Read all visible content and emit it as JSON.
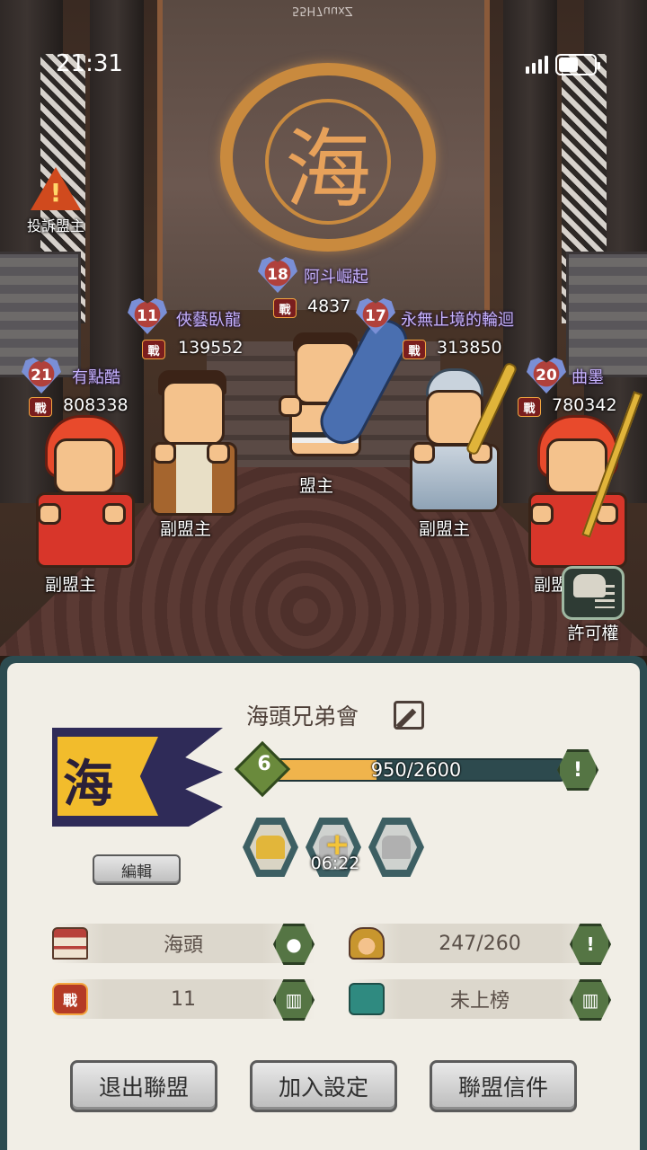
{
  "status_bar": {
    "time": "21:31",
    "battery_level": 0.55
  },
  "hall": {
    "banner_char": "海",
    "banner_id": "55H7uuxZ",
    "report_button_label": "投訴盟主",
    "permission_button_label": "許可權"
  },
  "members": [
    {
      "level": "18",
      "name": "阿斗崛起",
      "power": "4837",
      "role": "盟主"
    },
    {
      "level": "11",
      "name": "俠藝臥龍",
      "power": "139552",
      "role": "副盟主"
    },
    {
      "level": "17",
      "name": "永無止境的輪迴",
      "power": "313850",
      "role": "副盟主"
    },
    {
      "level": "21",
      "name": "有點酷",
      "power": "808338",
      "role": "副盟主"
    },
    {
      "level": "20",
      "name": "曲墨",
      "power": "780342",
      "role": "副盟"
    }
  ],
  "power_badge_label": "戰",
  "guild": {
    "flag_char": "海",
    "edit_button_label": "編輯",
    "name": "海頭兄弟會",
    "level": "6",
    "xp_text": "950/2600",
    "xp_fraction": 0.365,
    "buff_timer": "06:22",
    "stats": {
      "city": "海頭",
      "members": "247/260",
      "power": "11",
      "rank": "未上榜"
    }
  },
  "actions": {
    "leave_label": "退出聯盟",
    "join_settings_label": "加入設定",
    "mail_label": "聯盟信件"
  },
  "colors": {
    "panel_border": "#2c4b50",
    "panel_bg": "#f1eee6",
    "xp_fill": "#f0b44c",
    "member_name": "#c7b2ff"
  }
}
